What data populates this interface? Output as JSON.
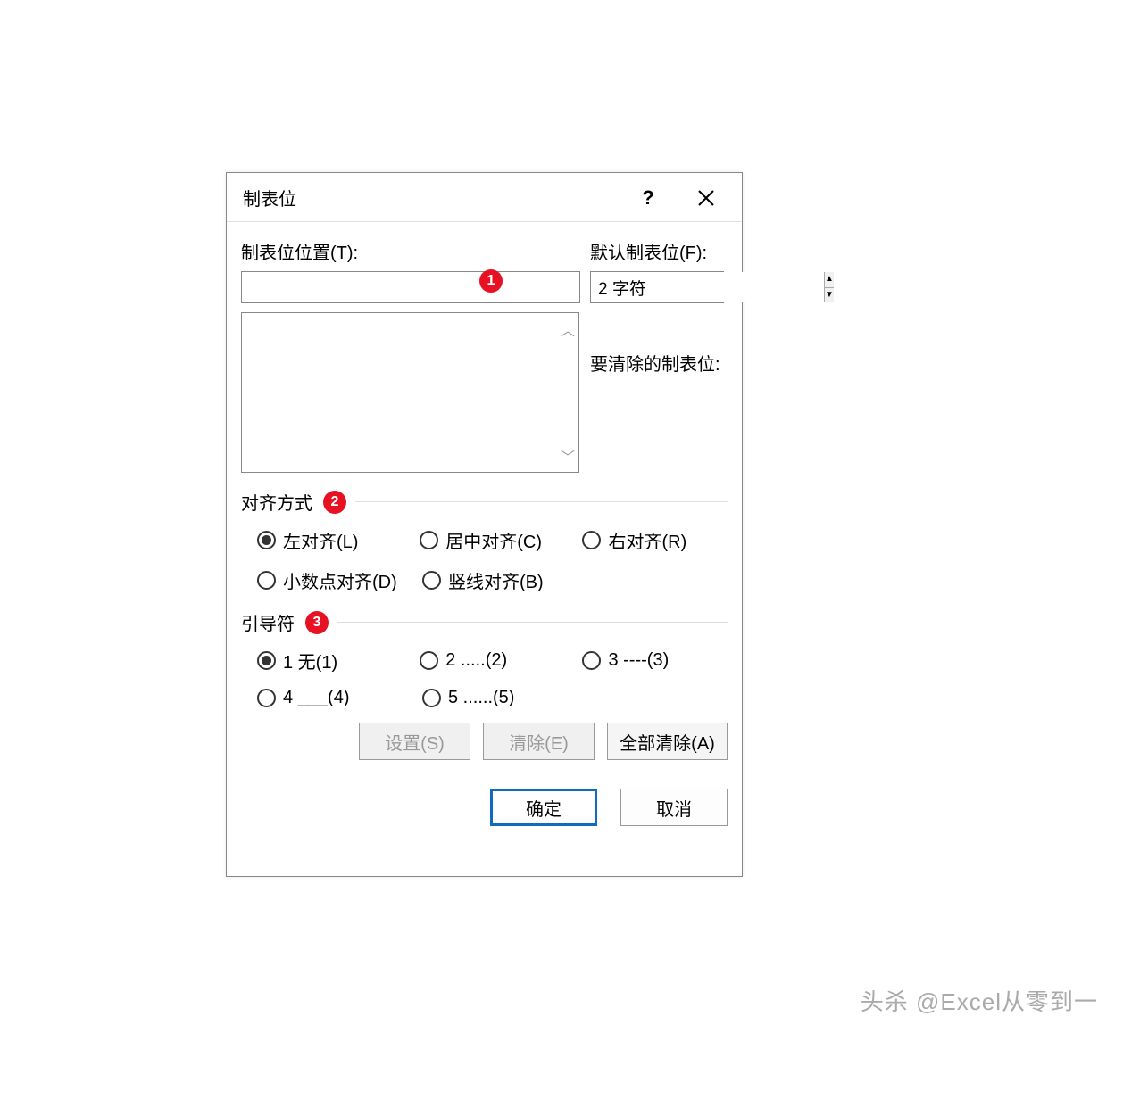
{
  "dialog": {
    "title": "制表位",
    "tabPositionLabel": "制表位位置(T):",
    "defaultTabLabel": "默认制表位(F):",
    "defaultTabValue": "2 字符",
    "clearLabel": "要清除的制表位:",
    "alignSection": "对齐方式",
    "alignOptions": {
      "left": "左对齐(L)",
      "center": "居中对齐(C)",
      "right": "右对齐(R)",
      "decimal": "小数点对齐(D)",
      "bar": "竖线对齐(B)"
    },
    "leaderSection": "引导符",
    "leaderOptions": {
      "none": "1 无(1)",
      "dots": "2 .....(2)",
      "dashes": "3 ----(3)",
      "underline": "4 ___(4)",
      "dots2": "5 ......(5)"
    },
    "buttons": {
      "set": "设置(S)",
      "clear": "清除(E)",
      "clearAll": "全部清除(A)",
      "ok": "确定",
      "cancel": "取消"
    },
    "annotations": {
      "a1": "1",
      "a2": "2",
      "a3": "3"
    }
  },
  "watermark": "头杀 @Excel从零到一"
}
